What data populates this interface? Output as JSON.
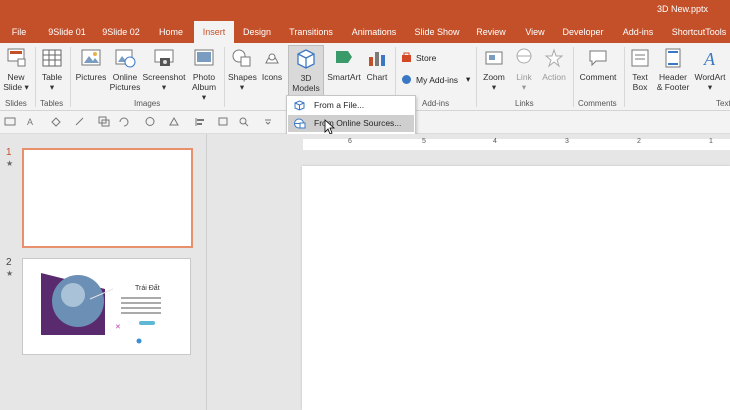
{
  "window": {
    "title": "3D New.pptx"
  },
  "tabs": [
    "File",
    "9Slide 01",
    "9Slide 02",
    "Home",
    "Insert",
    "Design",
    "Transitions",
    "Animations",
    "Slide Show",
    "Review",
    "View",
    "Developer",
    "Add-ins",
    "ShortcutTools"
  ],
  "active_tab": "Insert",
  "ribbon": {
    "new_slide": "New Slide",
    "new_slide_l1": "New",
    "new_slide_l2": "Slide",
    "table": "Table",
    "pictures": "Pictures",
    "online_pictures_l1": "Online",
    "online_pictures_l2": "Pictures",
    "screenshot": "Screenshot",
    "photo_album_l1": "Photo",
    "photo_album_l2": "Album",
    "shapes": "Shapes",
    "icons": "Icons",
    "models_l1": "3D",
    "models_l2": "Models",
    "smartart": "SmartArt",
    "chart": "Chart",
    "store": "Store",
    "my_addins": "My Add-ins",
    "zoom": "Zoom",
    "link": "Link",
    "action": "Action",
    "comment": "Comment",
    "textbox_l1": "Text",
    "textbox_l2": "Box",
    "header_l1": "Header",
    "header_l2": "& Footer",
    "wordart": "WordArt",
    "groups": {
      "slides": "Slides",
      "tables": "Tables",
      "images": "Images",
      "addins": "Add-ins",
      "links": "Links",
      "comments": "Comments",
      "text": "Text"
    }
  },
  "dropdown": {
    "from_file": "From a File...",
    "from_online": "From Online Sources..."
  },
  "slides": [
    {
      "number": "1",
      "title": ""
    },
    {
      "number": "2",
      "title": "Trái Đất"
    }
  ],
  "ruler_labels": [
    "6",
    "5",
    "4",
    "3",
    "2",
    "1"
  ],
  "colors": {
    "accent": "#c4502a",
    "selected_border": "#e8906b"
  }
}
